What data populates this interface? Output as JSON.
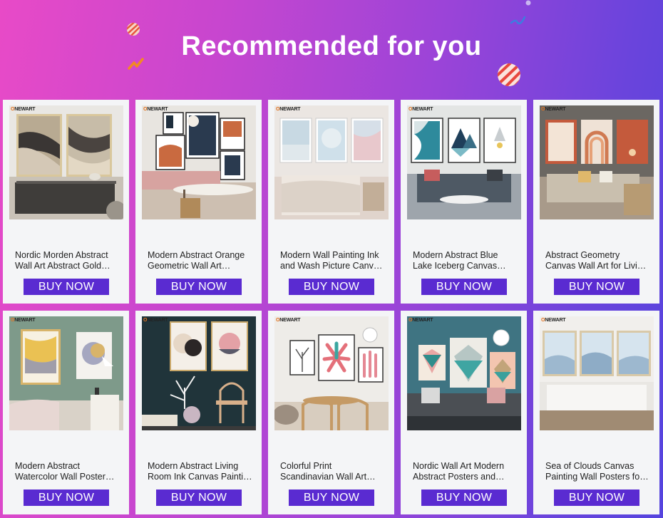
{
  "header": {
    "title": "Recommended for you"
  },
  "brand_prefix": "O",
  "brand_suffix": "NEWART",
  "products": [
    {
      "name": "Nordic Morden Abstract Wall Art Abstract Gold Marble Canvas Painting",
      "buy_label": "BUY NOW"
    },
    {
      "name": "Modern Abstract Orange Geometric Wall Art Canvas Painting",
      "buy_label": "BUY NOW"
    },
    {
      "name": "Modern Wall Painting Ink and Wash Picture Canvas Poster",
      "buy_label": "BUY NOW"
    },
    {
      "name": "Modern Abstract Blue Lake Iceberg Canvas Painting Poster",
      "buy_label": "BUY NOW"
    },
    {
      "name": "Abstract Geometry Canvas Wall Art for Living Room",
      "buy_label": "BUY NOW"
    },
    {
      "name": "Modern Abstract Watercolor Wall Poster Canvas Painting",
      "buy_label": "BUY NOW"
    },
    {
      "name": "Modern Abstract Living Room Ink Canvas Painting Poster",
      "buy_label": "BUY NOW"
    },
    {
      "name": "Colorful Print Scandinavian Wall Art Feather Leaf Poster",
      "buy_label": "BUY NOW"
    },
    {
      "name": "Nordic Wall Art Modern Abstract Posters and Prints",
      "buy_label": "BUY NOW"
    },
    {
      "name": "Sea of Clouds Canvas Painting Wall Posters for Living Room",
      "buy_label": "BUY NOW"
    }
  ],
  "colors": {
    "buy_button": "#5a2bd1",
    "card_bg": "#f4f5f7",
    "gradient_start": "#e84ac7",
    "gradient_end": "#5544de"
  }
}
